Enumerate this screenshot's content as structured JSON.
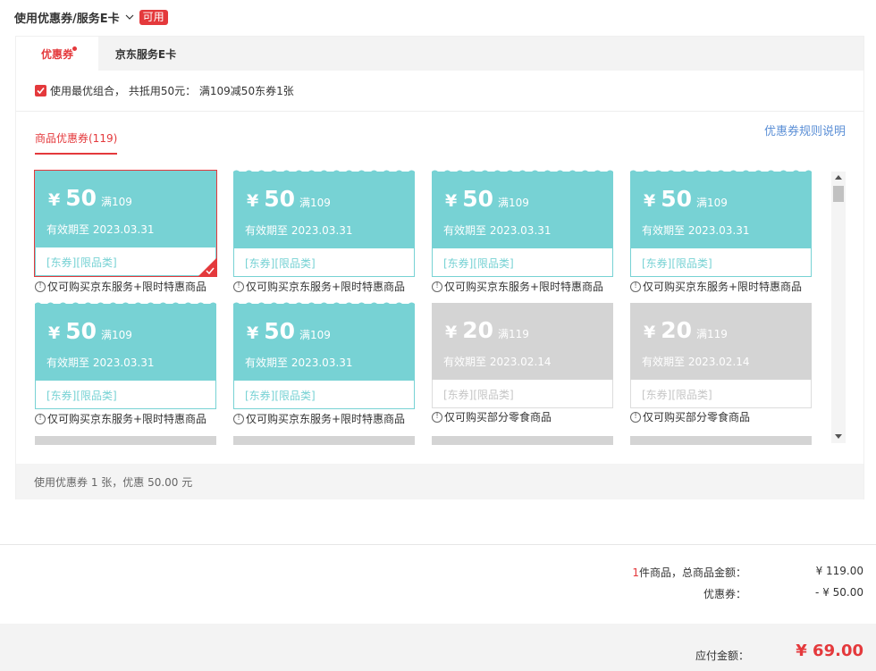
{
  "header": {
    "title": "使用优惠券/服务E卡",
    "badge": "可用"
  },
  "tabs": [
    {
      "label": "优惠券",
      "active": true
    },
    {
      "label": "京东服务E卡",
      "active": false
    }
  ],
  "combo": {
    "checked": true,
    "text": "使用最优组合， 共抵用50元： 满109减50东券1张"
  },
  "subtab": {
    "label": "商品优惠券(119)"
  },
  "rules_link": "优惠券规则说明",
  "coupons": [
    {
      "yen": "¥",
      "amount": "50",
      "cond": "满109",
      "valid": "有效期至 2023.03.31",
      "tag": "[东券][限品类]",
      "note": "仅可购买京东服务+限时特惠商品",
      "state": "selected"
    },
    {
      "yen": "¥",
      "amount": "50",
      "cond": "满109",
      "valid": "有效期至 2023.03.31",
      "tag": "[东券][限品类]",
      "note": "仅可购买京东服务+限时特惠商品",
      "state": "available"
    },
    {
      "yen": "¥",
      "amount": "50",
      "cond": "满109",
      "valid": "有效期至 2023.03.31",
      "tag": "[东券][限品类]",
      "note": "仅可购买京东服务+限时特惠商品",
      "state": "available"
    },
    {
      "yen": "¥",
      "amount": "50",
      "cond": "满109",
      "valid": "有效期至 2023.03.31",
      "tag": "[东券][限品类]",
      "note": "仅可购买京东服务+限时特惠商品",
      "state": "available"
    },
    {
      "yen": "¥",
      "amount": "50",
      "cond": "满109",
      "valid": "有效期至 2023.03.31",
      "tag": "[东券][限品类]",
      "note": "仅可购买京东服务+限时特惠商品",
      "state": "available"
    },
    {
      "yen": "¥",
      "amount": "50",
      "cond": "满109",
      "valid": "有效期至 2023.03.31",
      "tag": "[东券][限品类]",
      "note": "仅可购买京东服务+限时特惠商品",
      "state": "available"
    },
    {
      "yen": "¥",
      "amount": "20",
      "cond": "满119",
      "valid": "有效期至 2023.02.14",
      "tag": "[东券][限品类]",
      "note": "仅可购买部分零食商品",
      "state": "unavailable"
    },
    {
      "yen": "¥",
      "amount": "20",
      "cond": "满119",
      "valid": "有效期至 2023.02.14",
      "tag": "[东券][限品类]",
      "note": "仅可购买部分零食商品",
      "state": "unavailable"
    }
  ],
  "summary_bar": "使用优惠券 1 张，优惠 50.00 元",
  "totals": {
    "count_num": "1",
    "count_label": "件商品，总商品金额：",
    "goods_amount": "¥ 119.00",
    "coupon_label": "优惠券：",
    "coupon_amount": "- ¥ 50.00",
    "pay_label": "应付金额：",
    "pay_amount": "¥ 69.00"
  },
  "colors": {
    "accent": "#e4393c",
    "coupon": "#77d2d4",
    "coupon_disabled": "#d4d4d4",
    "link": "#5b8fd6"
  }
}
